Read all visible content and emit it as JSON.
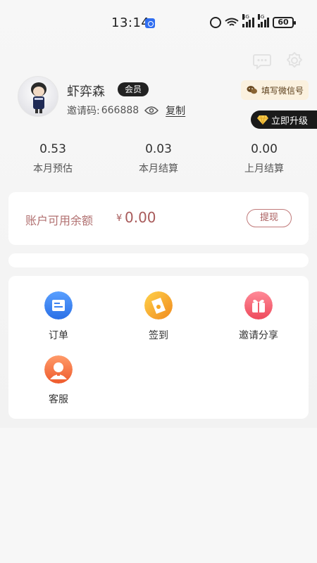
{
  "status_bar": {
    "time": "13:14",
    "net1_label": "4G",
    "net2_label": "5G",
    "battery": "60"
  },
  "profile": {
    "username": "虾弈森",
    "badge": "会员",
    "invite_label": "邀请码:",
    "invite_code": "666888",
    "copy_label": "复制",
    "wechat_label": "填写微信号",
    "upgrade_label": "立即升级"
  },
  "stats": [
    {
      "value": "0.53",
      "label": "本月预估"
    },
    {
      "value": "0.03",
      "label": "本月结算"
    },
    {
      "value": "0.00",
      "label": "上月结算"
    }
  ],
  "balance": {
    "label": "账户可用余额",
    "currency": "¥",
    "value": "0.00",
    "withdraw_label": "提现"
  },
  "menu": [
    {
      "label": "订单",
      "icon": "order-icon",
      "color": "#3c82f0"
    },
    {
      "label": "签到",
      "icon": "checkin-icon",
      "color": "#f5a623"
    },
    {
      "label": "邀请分享",
      "icon": "gift-icon",
      "color": "#f25c6c"
    },
    {
      "label": "客服",
      "icon": "customer-service-icon",
      "color": "#f2683a"
    }
  ],
  "colors": {
    "balance_accent": "#a85a5a",
    "wechat_bg": "#fbf1df",
    "upgrade_bg": "#1a1a1a"
  }
}
